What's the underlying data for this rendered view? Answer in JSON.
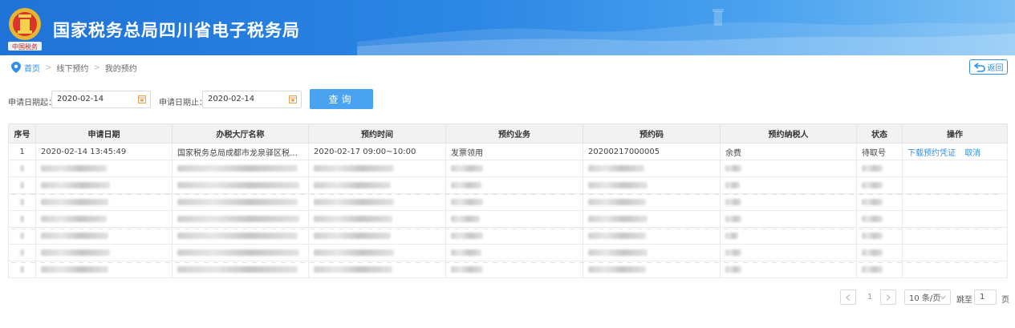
{
  "header": {
    "title": "国家税务总局四川省电子税务局",
    "brand_color": "#2b86e4",
    "emblem_text": "中国税务"
  },
  "breadcrumb": {
    "home": "首页",
    "level1": "线下预约",
    "level2": "我的预约",
    "sep": ">"
  },
  "back_button": {
    "label": "返回"
  },
  "query": {
    "start_label": "申请日期起：",
    "start_value": "2020-02-14",
    "end_label": "申请日期止：",
    "end_value": "2020-02-14",
    "search_label": "查询"
  },
  "table": {
    "columns": [
      "序号",
      "申请日期",
      "办税大厅名称",
      "预约时间",
      "预约业务",
      "预约码",
      "预约纳税人",
      "状态",
      "操作"
    ],
    "row1": {
      "index": "1",
      "date": "2020-02-14 13:45:49",
      "hall": "国家税务总局成都市龙泉驿区税务局...",
      "time": "2020-02-17 09:00~10:00",
      "business": "发票领用",
      "code": "20200217000005",
      "taxpayer": "余费",
      "status": "待取号",
      "action_download": "下载预约凭证",
      "action_cancel": "取消"
    }
  },
  "pagination": {
    "page": "1",
    "page_size": "10 条/页",
    "jump_label": "跳至",
    "jump_value": "1",
    "page_unit": "页"
  }
}
